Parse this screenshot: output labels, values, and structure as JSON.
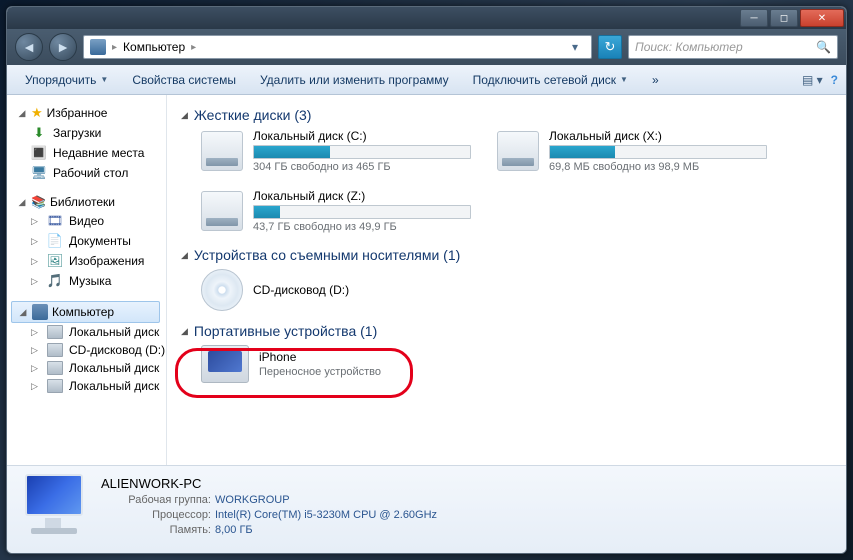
{
  "breadcrumb": {
    "root": "Компьютер"
  },
  "search": {
    "placeholder": "Поиск: Компьютер"
  },
  "toolbar": {
    "organize": "Упорядочить",
    "props": "Свойства системы",
    "uninstall": "Удалить или изменить программу",
    "mapdrive": "Подключить сетевой диск",
    "more": "»"
  },
  "sidebar": {
    "favorites": "Избранное",
    "downloads": "Загрузки",
    "recent": "Недавние места",
    "desktop": "Рабочий стол",
    "libraries": "Библиотеки",
    "video": "Видео",
    "documents": "Документы",
    "images": "Изображения",
    "music": "Музыка",
    "computer": "Компьютер",
    "driveC": "Локальный диск",
    "driveD": "CD-дисковод (D:)",
    "driveX": "Локальный диск",
    "driveZ": "Локальный диск"
  },
  "sections": {
    "hdd": "Жесткие диски (3)",
    "removable": "Устройства со съемными носителями (1)",
    "portable": "Портативные устройства (1)"
  },
  "drives": {
    "c": {
      "name": "Локальный диск (C:)",
      "sub": "304 ГБ свободно из 465 ГБ",
      "pct": 35
    },
    "x": {
      "name": "Локальный диск (X:)",
      "sub": "69,8 МБ свободно из 98,9 МБ",
      "pct": 30
    },
    "z": {
      "name": "Локальный диск (Z:)",
      "sub": "43,7 ГБ свободно из 49,9 ГБ",
      "pct": 12
    },
    "d": {
      "name": "CD-дисковод (D:)"
    }
  },
  "portable": {
    "name": "iPhone",
    "sub": "Переносное устройство"
  },
  "details": {
    "name": "ALIENWORK-PC",
    "workgroup_lbl": "Рабочая группа:",
    "workgroup": "WORKGROUP",
    "cpu_lbl": "Процессор:",
    "cpu": "Intel(R) Core(TM) i5-3230M CPU @ 2.60GHz",
    "mem_lbl": "Память:",
    "mem": "8,00 ГБ"
  }
}
